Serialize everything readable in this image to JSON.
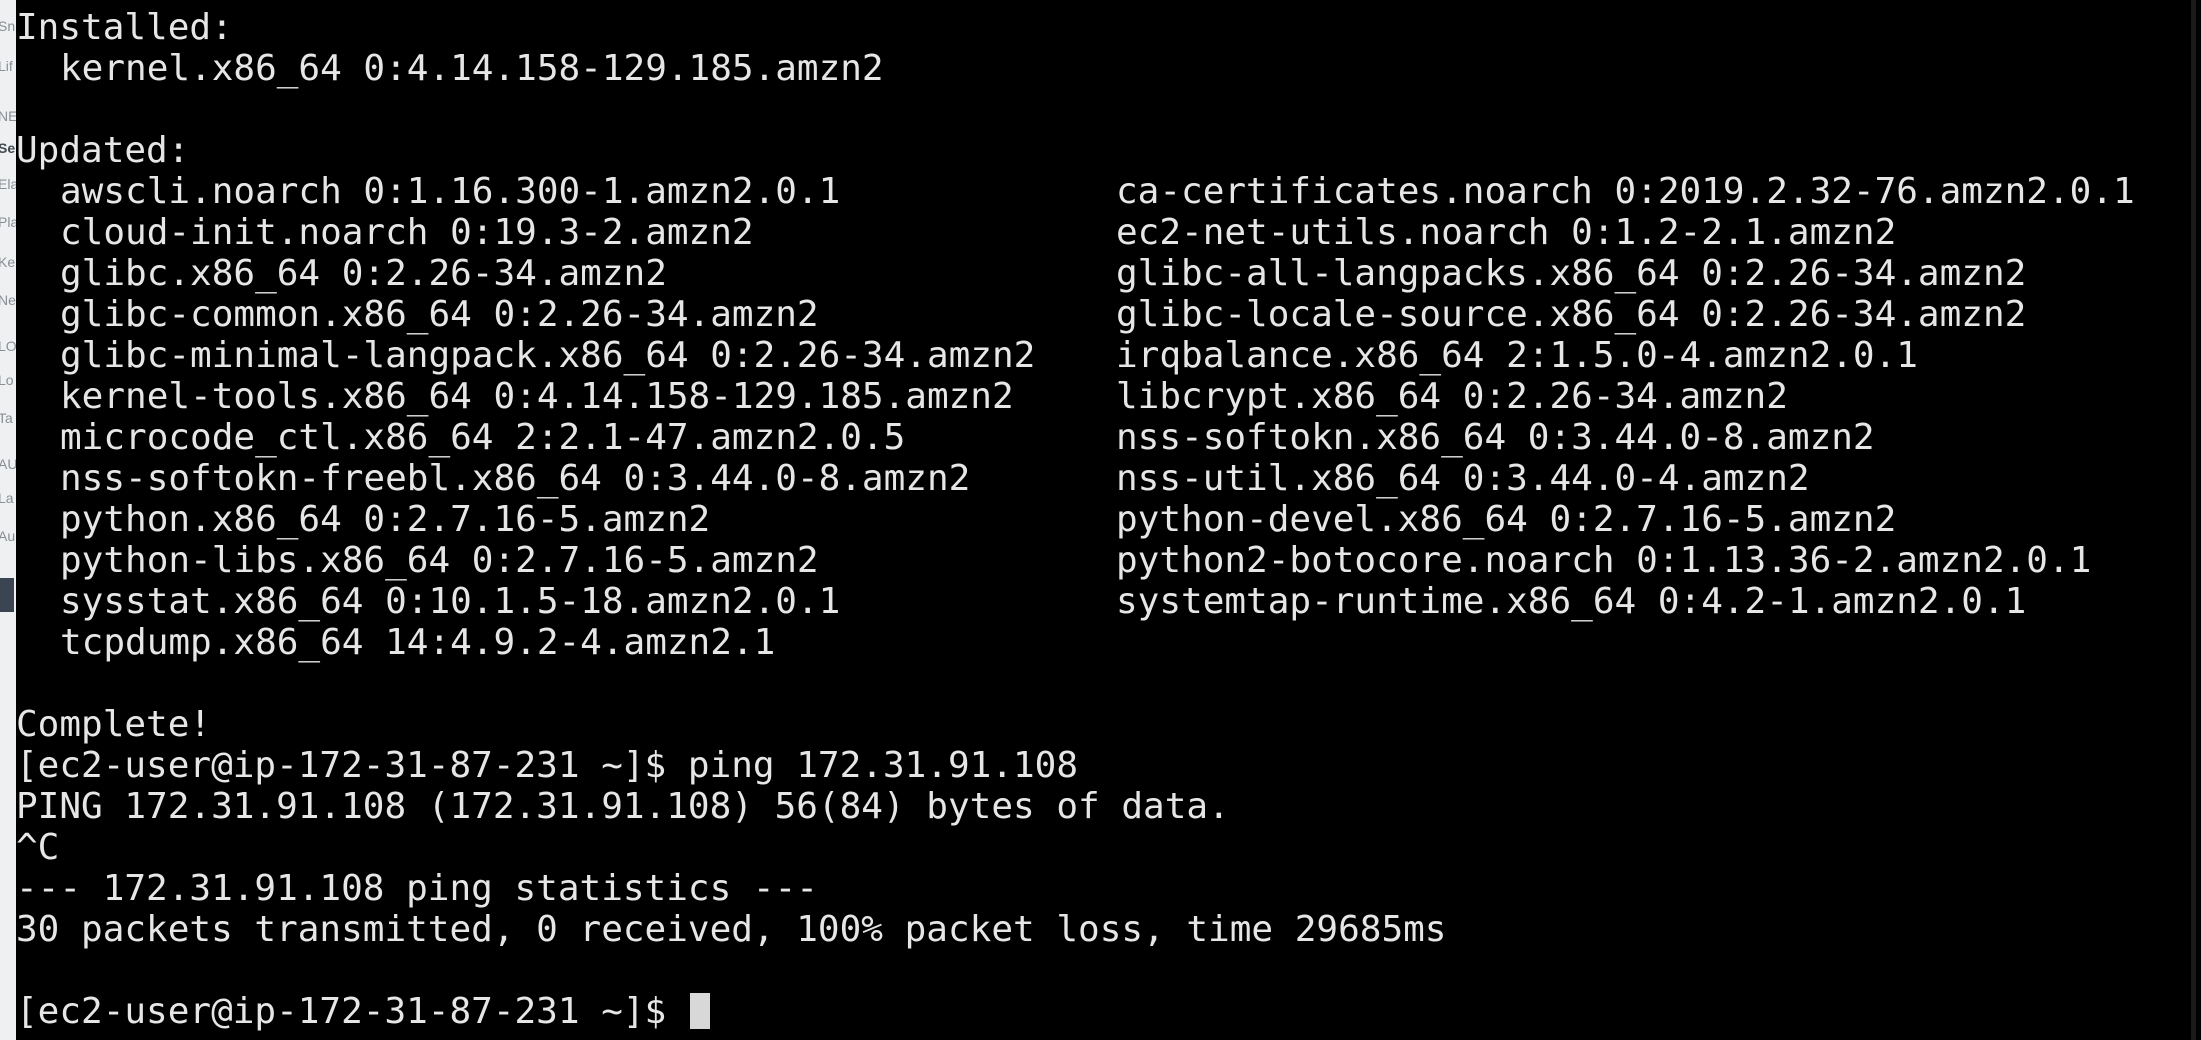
{
  "background_window": {
    "fragments": [
      {
        "text": "Sn",
        "bold": false
      },
      {
        "text": "Lif",
        "bold": false
      },
      {
        "text": "NE",
        "bold": false
      },
      {
        "text": "Se",
        "bold": true
      },
      {
        "text": "Ela",
        "bold": false
      },
      {
        "text": "Pla",
        "bold": false
      },
      {
        "text": "Ke",
        "bold": false
      },
      {
        "text": "Ne",
        "bold": false
      },
      {
        "text": "LO",
        "bold": false
      },
      {
        "text": "Lo",
        "bold": false
      },
      {
        "text": "Ta",
        "bold": false
      },
      {
        "text": "AU",
        "bold": false
      },
      {
        "text": "La",
        "bold": false
      },
      {
        "text": "Au",
        "bold": false
      }
    ]
  },
  "terminal": {
    "installed_header": "Installed:",
    "installed_packages": [
      "kernel.x86_64 0:4.14.158-129.185.amzn2"
    ],
    "updated_header": "Updated:",
    "updated_packages": [
      {
        "left": "awscli.noarch 0:1.16.300-1.amzn2.0.1",
        "right": "ca-certificates.noarch 0:2019.2.32-76.amzn2.0.1"
      },
      {
        "left": "cloud-init.noarch 0:19.3-2.amzn2",
        "right": "ec2-net-utils.noarch 0:1.2-2.1.amzn2"
      },
      {
        "left": "glibc.x86_64 0:2.26-34.amzn2",
        "right": "glibc-all-langpacks.x86_64 0:2.26-34.amzn2"
      },
      {
        "left": "glibc-common.x86_64 0:2.26-34.amzn2",
        "right": "glibc-locale-source.x86_64 0:2.26-34.amzn2"
      },
      {
        "left": "glibc-minimal-langpack.x86_64 0:2.26-34.amzn2",
        "right": "irqbalance.x86_64 2:1.5.0-4.amzn2.0.1"
      },
      {
        "left": "kernel-tools.x86_64 0:4.14.158-129.185.amzn2",
        "right": "libcrypt.x86_64 0:2.26-34.amzn2"
      },
      {
        "left": "microcode_ctl.x86_64 2:2.1-47.amzn2.0.5",
        "right": "nss-softokn.x86_64 0:3.44.0-8.amzn2"
      },
      {
        "left": "nss-softokn-freebl.x86_64 0:3.44.0-8.amzn2",
        "right": "nss-util.x86_64 0:3.44.0-4.amzn2"
      },
      {
        "left": "python.x86_64 0:2.7.16-5.amzn2",
        "right": "python-devel.x86_64 0:2.7.16-5.amzn2"
      },
      {
        "left": "python-libs.x86_64 0:2.7.16-5.amzn2",
        "right": "python2-botocore.noarch 0:1.13.36-2.amzn2.0.1"
      },
      {
        "left": "sysstat.x86_64 0:10.1.5-18.amzn2.0.1",
        "right": "systemtap-runtime.x86_64 0:4.2-1.amzn2.0.1"
      },
      {
        "left": "tcpdump.x86_64 14:4.9.2-4.amzn2.1",
        "right": ""
      }
    ],
    "complete": "Complete!",
    "prompt_ping": "[ec2-user@ip-172-31-87-231 ~]$ ping 172.31.91.108",
    "ping_header": "PING 172.31.91.108 (172.31.91.108) 56(84) bytes of data.",
    "interrupt": "^C",
    "stats_header": "--- 172.31.91.108 ping statistics ---",
    "stats_result": "30 packets transmitted, 0 received, 100% packet loss, time 29685ms",
    "final_prompt": "[ec2-user@ip-172-31-87-231 ~]$ "
  },
  "colors": {
    "terminal_bg": "#000000",
    "terminal_fg": "#e6e6e6",
    "cursor": "#d8d8d8"
  }
}
